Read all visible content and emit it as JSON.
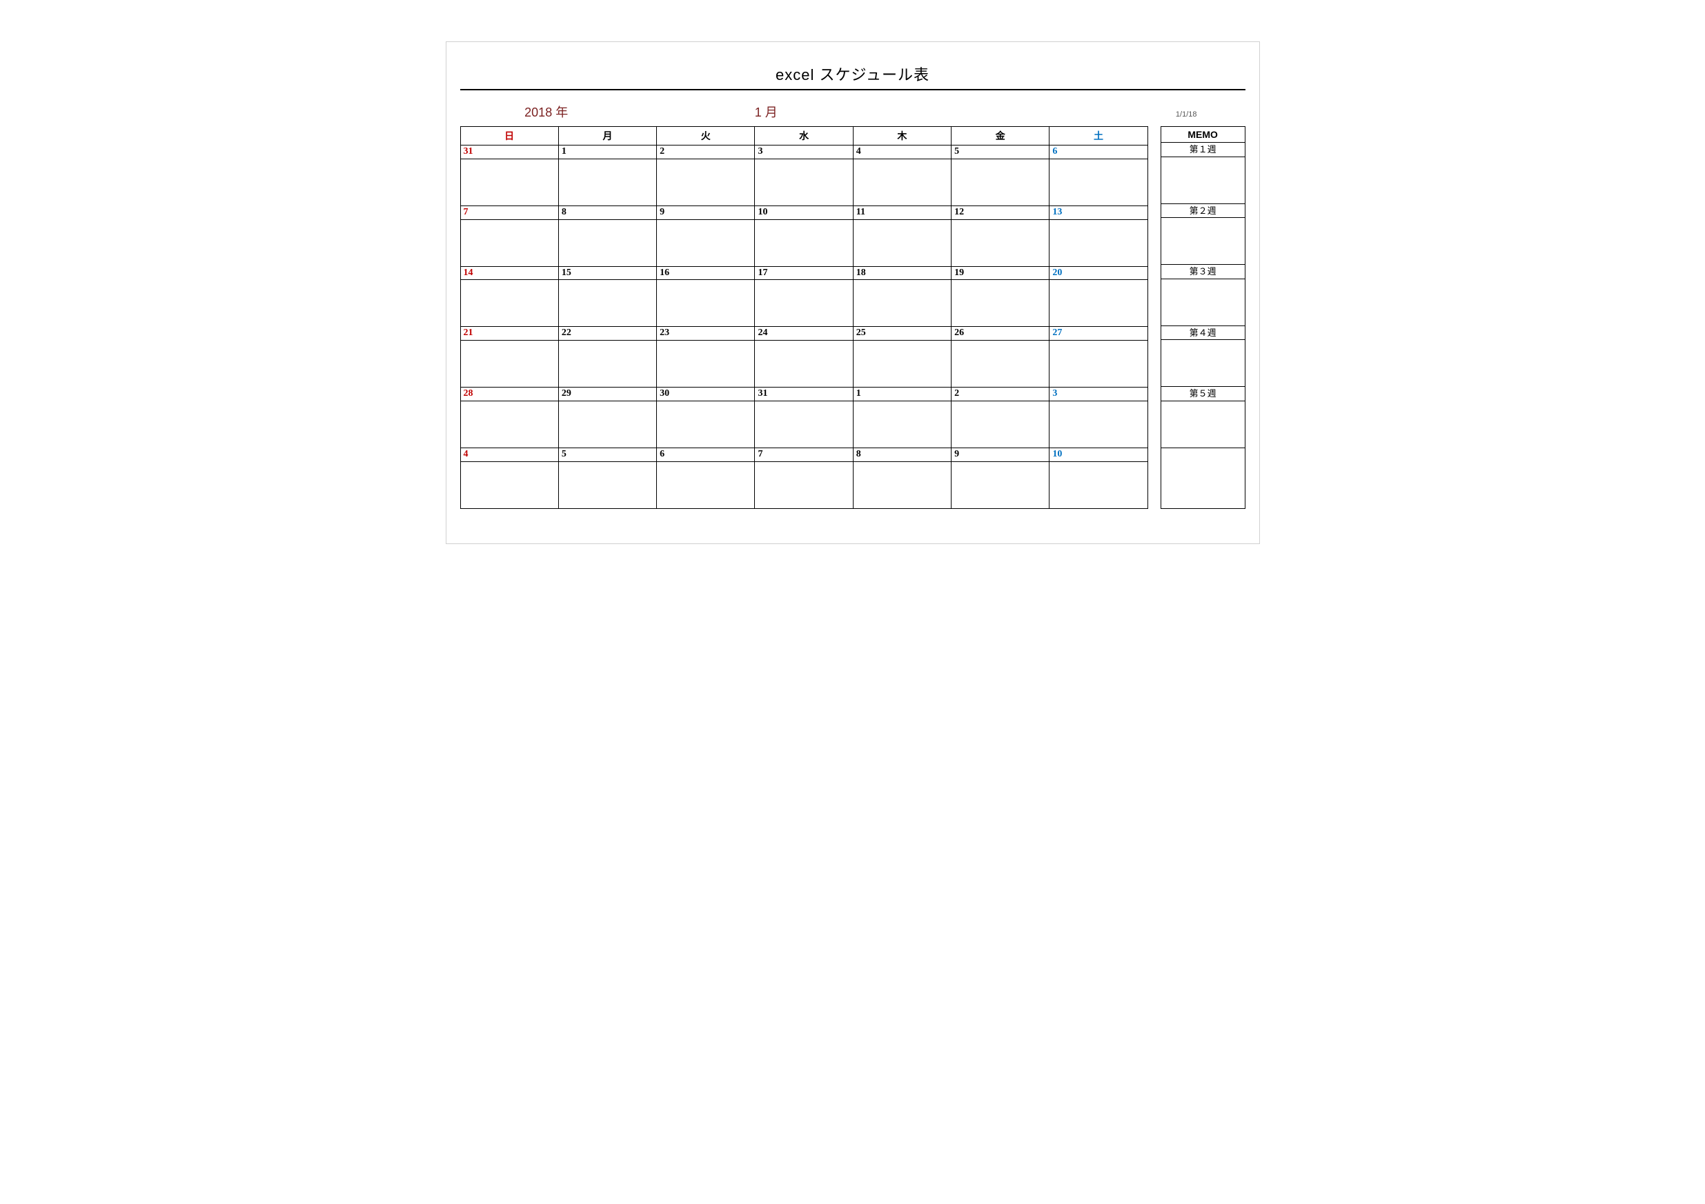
{
  "title": "excel スケジュール表",
  "year_label": "2018 年",
  "month_label": "1 月",
  "date_stamp": "1/1/18",
  "day_headers": [
    "日",
    "月",
    "火",
    "水",
    "木",
    "金",
    "土"
  ],
  "weeks": [
    {
      "memo": "第１週",
      "days": [
        "31",
        "1",
        "2",
        "3",
        "4",
        "5",
        "6"
      ]
    },
    {
      "memo": "第２週",
      "days": [
        "7",
        "8",
        "9",
        "10",
        "11",
        "12",
        "13"
      ]
    },
    {
      "memo": "第３週",
      "days": [
        "14",
        "15",
        "16",
        "17",
        "18",
        "19",
        "20"
      ]
    },
    {
      "memo": "第４週",
      "days": [
        "21",
        "22",
        "23",
        "24",
        "25",
        "26",
        "27"
      ]
    },
    {
      "memo": "第５週",
      "days": [
        "28",
        "29",
        "30",
        "31",
        "1",
        "2",
        "3"
      ]
    },
    {
      "memo": "",
      "days": [
        "4",
        "5",
        "6",
        "7",
        "8",
        "9",
        "10"
      ]
    }
  ],
  "memo_header": "MEMO"
}
